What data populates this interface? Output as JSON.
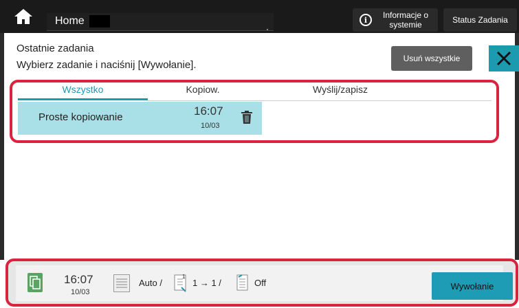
{
  "topbar": {
    "home_label": "Home",
    "info_label": "Informacje o systemie",
    "status_label": "Status Zadania"
  },
  "header": {
    "title": "Ostatnie zadania",
    "subtitle": "Wybierz zadanie i naciśnij [Wywołanie].",
    "delete_all_label": "Usuń wszystkie",
    "close_icon": "close-icon"
  },
  "tabs": [
    {
      "label": "Wszystko",
      "active": true
    },
    {
      "label": "Kopiow.",
      "active": false
    },
    {
      "label": "Wyślij/zapisz",
      "active": false
    }
  ],
  "jobs": [
    {
      "name": "Proste kopiowanie",
      "time": "16:07",
      "date": "10/03",
      "selected": true
    }
  ],
  "selected_job": {
    "time": "16:07",
    "date": "10/03",
    "paper": "Auto /",
    "duplex": "1 → 1 /",
    "finishing": "Off",
    "recall_label": "Wywołanie"
  },
  "colors": {
    "accent": "#1c9ab0",
    "highlight": "#d9243f",
    "selected_row": "#a9dfe6",
    "topbar": "#1a1a1a"
  }
}
